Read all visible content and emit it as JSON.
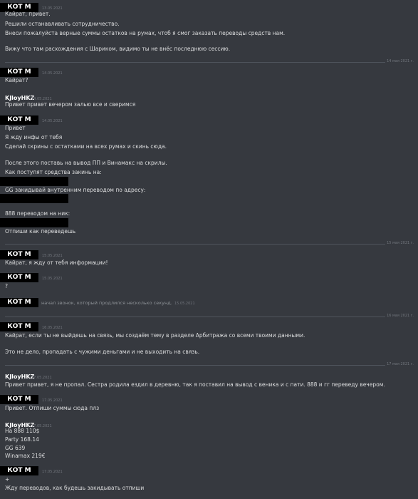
{
  "messages": [
    {
      "author": "КОТ М",
      "time": "13.05.2021",
      "lines": [
        "Кайрат, привет.",
        "Решили останавливать сотрудничество.",
        "Внеси пожалуйста верные суммы остатков на румах, чтоб я смог заказать переводы средств нам.",
        "",
        "Вижу что там расхождения с Шариком, видимо ты не внёс последнюю сессию."
      ]
    },
    {
      "divider": "14 мая 2021 г."
    },
    {
      "author": "КОТ М",
      "time": "14.05.2021",
      "lines": [
        "Кайрат?"
      ]
    },
    {
      "author": "KJloyHKZ",
      "time": "14.05.2021",
      "lines": [
        "Привет привет вечером залью все и сверимся"
      ]
    },
    {
      "author": "КОТ М",
      "time": "14.05.2021",
      "lines": [
        "Привет",
        "Я жду инфы от тебя",
        "Сделай скрины с остатками на всех румах и скинь сюда.",
        "",
        "После этого поставь на вывод ПП и Винамакс на скрилы.",
        "Как поступят средства закинь на:",
        "",
        "GG закидывай внутренним переводом по адресу:",
        "",
        "888 переводом на ник:",
        "",
        "Отпиши как переведешь"
      ]
    },
    {
      "divider": "15 мая 2021 г."
    },
    {
      "author": "КОТ М",
      "time": "15.05.2021",
      "lines": [
        "Кайрат, я жду от тебя информации!"
      ]
    },
    {
      "author": "КОТ М",
      "time": "15.05.2021",
      "lines": [
        "?"
      ]
    },
    {
      "author": "КОТ М",
      "system": "начал звонок, который продлился несколько секунд.",
      "time": "15.05.2021"
    },
    {
      "divider": "16 мая 2021 г."
    },
    {
      "author": "КОТ М",
      "time": "16.05.2021",
      "lines": [
        "Кайрат, если ты не выйдешь на связь, мы создаём тему в разделе Арбитража со всеми твоими данными.",
        "",
        "Это не дело, пропадать с чужими деньгами и не выходить на связь."
      ]
    },
    {
      "divider": "17 мая 2021 г."
    },
    {
      "author": "KJloyHKZ",
      "time": "17.05.2021",
      "lines": [
        "Привет привет, я не пропал. Сестра родила ездил в деревню, так я поставил на вывод с веника и с пати. 888 и гг переведу вечером."
      ]
    },
    {
      "author": "КОТ М",
      "time": "17.05.2021",
      "lines": [
        "Привет. Отпиши суммы сюда плз"
      ]
    },
    {
      "author": "KJloyHKZ",
      "time": "17.05.2021",
      "lines": [
        "На 888 110$",
        "Party 168.14",
        "GG 639",
        "Winamax 219€"
      ]
    },
    {
      "author": "КОТ М",
      "time": "17.05.2021",
      "lines": [
        "+",
        "Жду переводов, как будешь закидывать отпиши"
      ]
    }
  ],
  "colors": {
    "background": "#36393f",
    "text": "#dcddde",
    "timestamp": "#72767d",
    "divider": "#4f545c",
    "redaction": "#000000"
  }
}
